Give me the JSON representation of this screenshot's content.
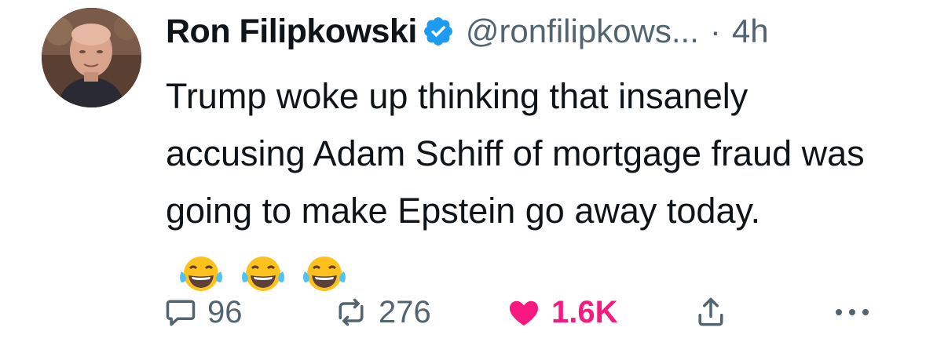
{
  "tweet": {
    "author_name": "Ron Filipkowski",
    "handle": "@ronfilipkows...",
    "separator": "·",
    "time": "4h",
    "verified": true,
    "text": "Trump woke up thinking that insanely accusing Adam Schiff of mortgage fraud was going to make Epstein go away today.",
    "emojis": [
      "face-with-tears-of-joy",
      "face-with-tears-of-joy",
      "face-with-tears-of-joy"
    ]
  },
  "actions": {
    "reply_count": "96",
    "retweet_count": "276",
    "like_count": "1.6K",
    "liked": true
  },
  "icons": {
    "reply": "reply-icon",
    "retweet": "retweet-icon",
    "like": "heart-icon",
    "share": "share-icon",
    "more": "more-icon",
    "verified": "verified-badge-icon"
  },
  "colors": {
    "text": "#0f1419",
    "muted": "#536471",
    "like": "#f91880",
    "verified": "#1d9bf0"
  }
}
